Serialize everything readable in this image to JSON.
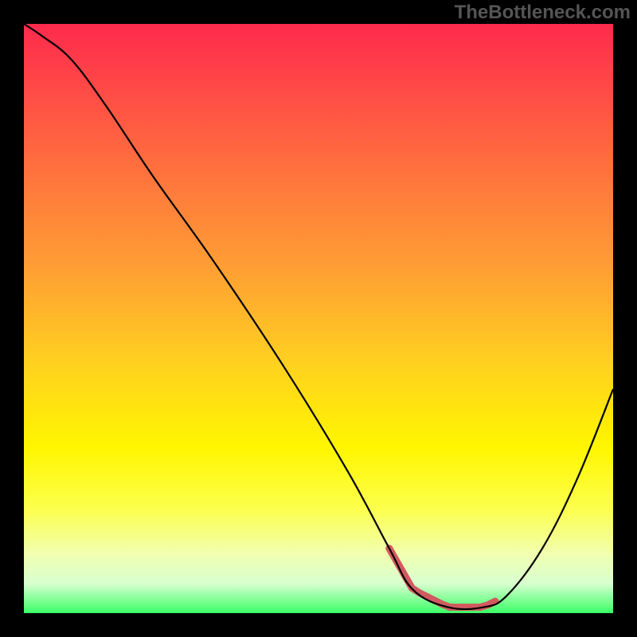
{
  "watermark": {
    "text": "TheBottleneck.com"
  },
  "colors": {
    "background": "#000000",
    "curve": "#000000",
    "highlight": "#d2595f",
    "gradient_top": "#ff2a4d",
    "gradient_bottom": "#3bff66"
  },
  "chart_data": {
    "type": "line",
    "title": "",
    "xlabel": "",
    "ylabel": "",
    "xlim": [
      0,
      100
    ],
    "ylim": [
      0,
      100
    ],
    "grid": false,
    "series": [
      {
        "name": "bottleneck_curve",
        "x": [
          0,
          3,
          8,
          14,
          22,
          32,
          44,
          55,
          62,
          66,
          72,
          78,
          82,
          88,
          94,
          100
        ],
        "values": [
          100,
          98,
          94,
          86,
          74,
          60,
          42,
          24,
          11,
          4,
          1,
          1,
          3,
          11,
          23,
          38
        ]
      }
    ],
    "annotations": [
      {
        "name": "optimal_range_highlight",
        "x_start": 62,
        "x_end": 80,
        "color": "#d2595f"
      }
    ]
  }
}
